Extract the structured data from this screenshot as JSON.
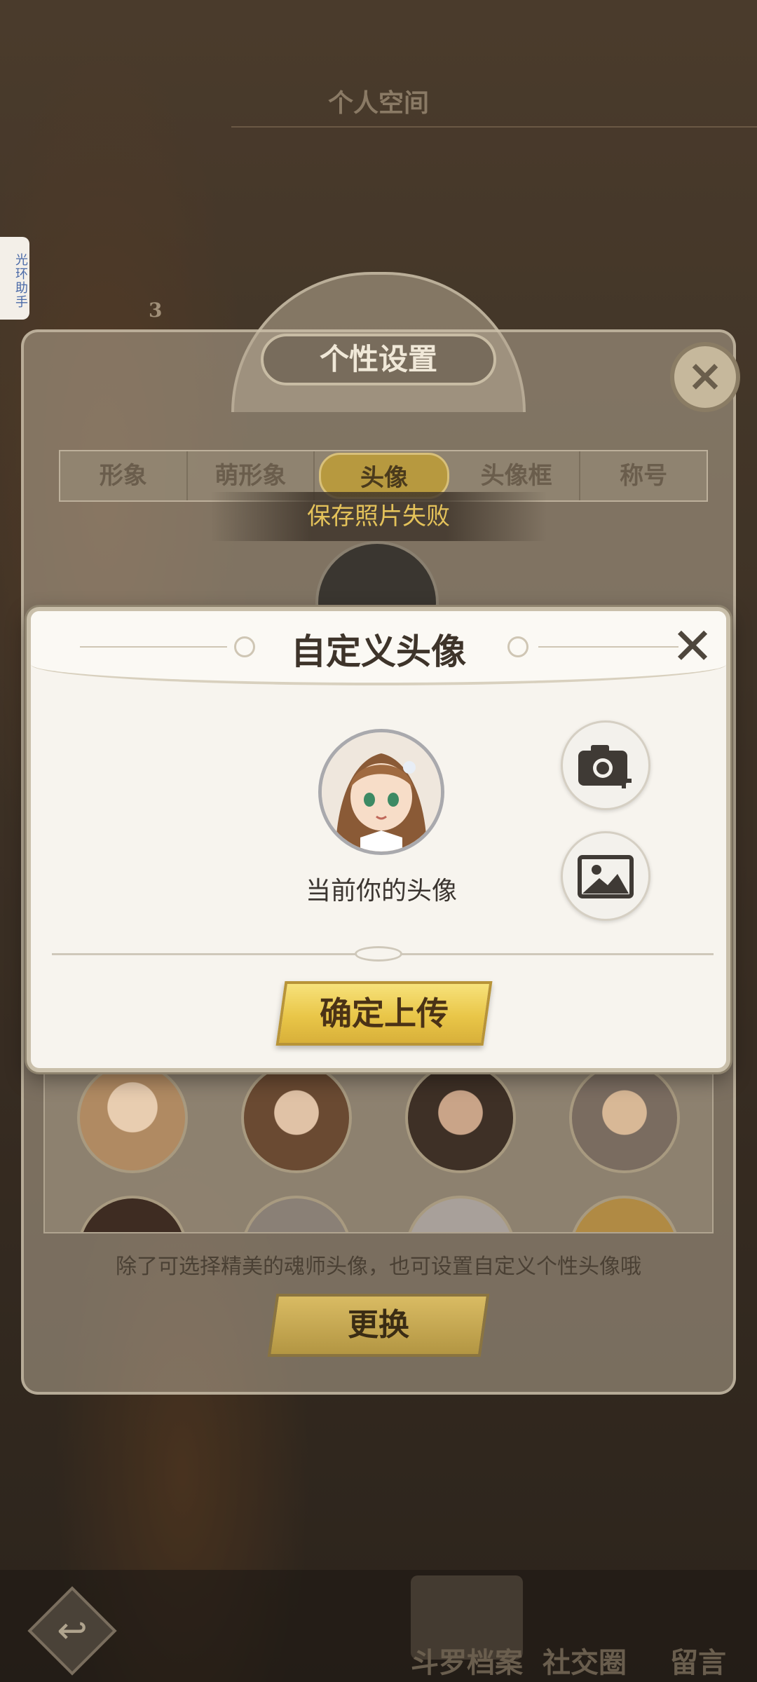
{
  "header": {
    "title": "个人空间"
  },
  "side_tab": {
    "label": "光环助手"
  },
  "rank_badge": {
    "number": "3"
  },
  "settings_panel": {
    "title": "个性设置",
    "tabs": [
      {
        "label": "形象",
        "active": false
      },
      {
        "label": "萌形象",
        "active": false
      },
      {
        "label": "头像",
        "active": true
      },
      {
        "label": "头像框",
        "active": false
      },
      {
        "label": "称号",
        "active": false
      }
    ],
    "toast": "保存照片失败",
    "hint": "除了可选择精美的魂师头像，也可设置自定义个性头像哦",
    "change_button": "更换"
  },
  "custom_avatar_dialog": {
    "title": "自定义头像",
    "current_label": "当前你的头像",
    "confirm_button": "确定上传",
    "actions": [
      "camera-plus-icon",
      "gallery-icon"
    ]
  },
  "bottom_nav": {
    "items": [
      {
        "label": "斗罗档案"
      },
      {
        "label": "社交圈"
      },
      {
        "label": "留言"
      }
    ]
  },
  "colors": {
    "accent_gold": "#e9c648",
    "toast_text": "#e4c25a",
    "dialog_bg": "#f7f4ee"
  }
}
